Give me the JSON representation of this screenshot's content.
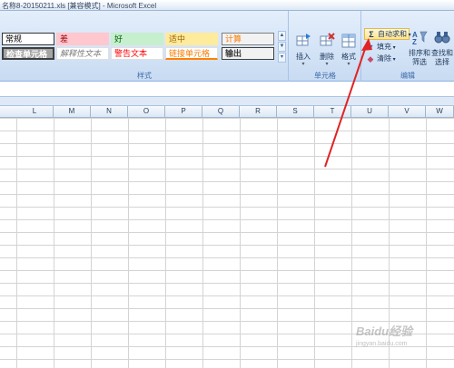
{
  "window": {
    "title": "名称8-20150211.xls [兼容模式] - Microsoft Excel"
  },
  "styles_group": {
    "label": "样式",
    "row1": [
      "常规",
      "差",
      "好",
      "适中",
      "计算"
    ],
    "row2": [
      "检查单元格",
      "解释性文本",
      "警告文本",
      "链接单元格",
      "输出"
    ],
    "colors": {
      "bad_fill": "#ffc7ce",
      "good_fill": "#c6efce",
      "neutral_fill": "#ffeb9c",
      "calc_fill": "#f2f2f2",
      "check_fill": "#a5a5a5"
    }
  },
  "cells_group": {
    "label": "单元格",
    "insert": "插入",
    "delete": "删除",
    "format": "格式"
  },
  "edit_group": {
    "label": "编辑",
    "autosum": "自动求和",
    "fill": "填充",
    "clear": "清除",
    "sort_filter": [
      "排序和",
      "筛选"
    ],
    "find_select": [
      "查找和",
      "选择"
    ]
  },
  "columns": [
    "L",
    "M",
    "N",
    "O",
    "P",
    "Q",
    "R",
    "S",
    "T",
    "U",
    "V",
    "W"
  ],
  "watermark": {
    "brand": "Baidu经验",
    "sub": "jingyan.baidu.com"
  }
}
